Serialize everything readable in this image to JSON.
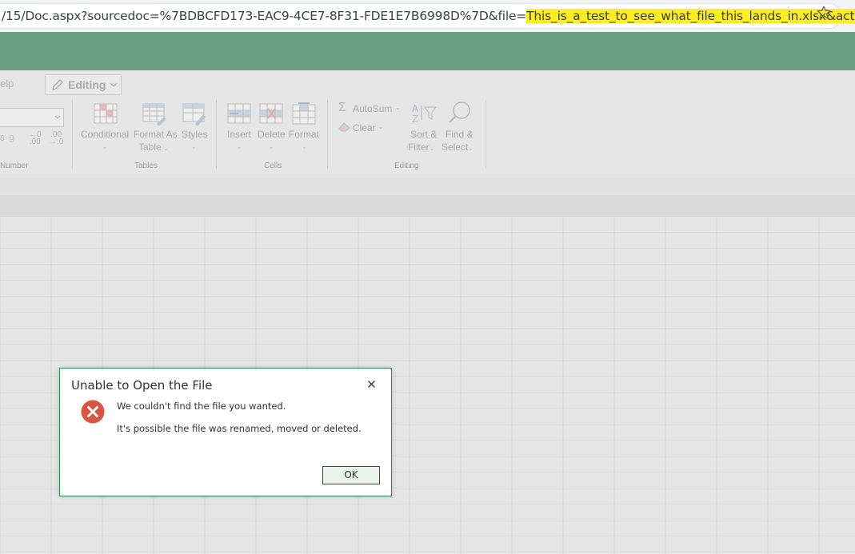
{
  "browser": {
    "url_prefix": "/15/Doc.aspx?sourcedoc=%7BDBCFD173-EAC9-4CE7-8F31-FDE1E7B6998D%7D&file=",
    "url_highlight": "This_is_a_test_to_see_what_file_this_lands_in.xlsx&actio...",
    "highlight_color": "#ffee1f",
    "bookmark_icon": "star-icon"
  },
  "header": {
    "color": "#69a081"
  },
  "ribbon": {
    "help_tab": "elp",
    "editing_button": "Editing",
    "number_group_label": "Number",
    "decimal_increase": ".00",
    "decimal_decrease": ".0",
    "tables_group": {
      "label": "Tables",
      "conditional": "Conditional",
      "format_as_table_line1": "Format As",
      "format_as_table_line2": "Table",
      "styles": "Styles"
    },
    "cells_group": {
      "label": "Cells",
      "insert": "Insert",
      "delete": "Delete",
      "format": "Format"
    },
    "editing_group": {
      "label": "Editing",
      "autosum": "AutoSum",
      "clear": "Clear",
      "sort_filter_line1": "Sort &",
      "sort_filter_line2": "Filter",
      "find_select_line1": "Find &",
      "find_select_line2": "Select"
    }
  },
  "dialog": {
    "title": "Unable to Open the File",
    "message_line1": "We couldn't find the file you wanted.",
    "message_line2": "It's possible the file was renamed, moved or deleted.",
    "ok_button": "OK",
    "border_color": "#2f8a52",
    "error_icon": "error-x-icon",
    "error_color": "#d9553f"
  }
}
